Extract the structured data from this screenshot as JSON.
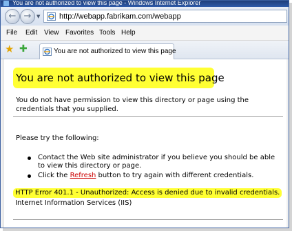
{
  "window": {
    "title": "You are not authorized to view this page - Windows Internet Explorer"
  },
  "address_bar": {
    "url": "http://webapp.fabrikam.com/webapp"
  },
  "menu": {
    "items": [
      "File",
      "Edit",
      "View",
      "Favorites",
      "Tools",
      "Help"
    ]
  },
  "tab": {
    "title": "You are not authorized to view this page"
  },
  "page": {
    "heading": "You are not authorized to view this page",
    "description": "You do not have permission to view this directory or page using the credentials that you supplied.",
    "try_intro": "Please try the following:",
    "bullet1": "Contact the Web site administrator if you believe you should be able to view this directory or page.",
    "bullet2_prefix": "Click the ",
    "bullet2_link": "Refresh",
    "bullet2_suffix": " button to try again with different credentials.",
    "error_code": "HTTP Error 401.1 - Unauthorized: Access is denied due to invalid credentials.",
    "server": "Internet Information Services (IIS)"
  },
  "colors": {
    "highlight": "#ffff33",
    "link": "#cc0000",
    "titlebar": "#2d5aa8"
  }
}
